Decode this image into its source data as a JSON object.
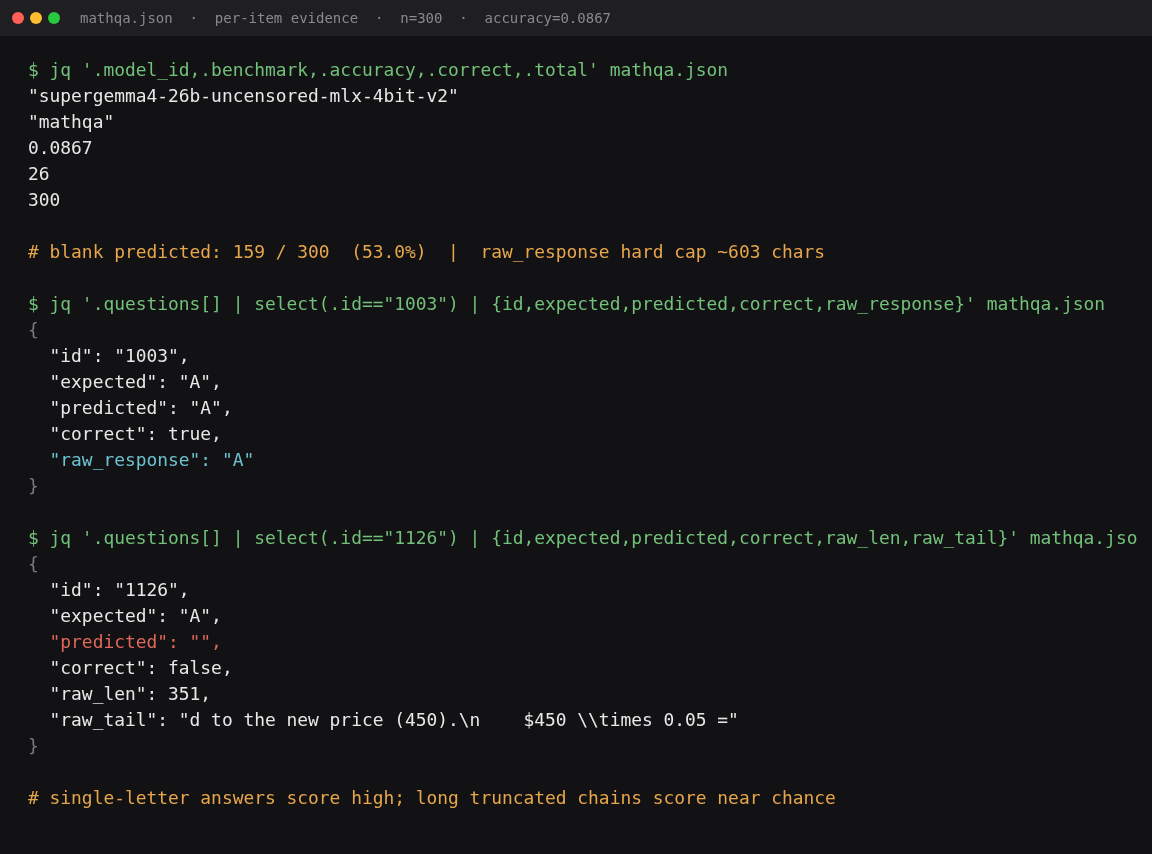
{
  "window": {
    "title": "mathqa.json  ·  per-item evidence  ·  n=300  ·  accuracy=0.0867"
  },
  "terminal": {
    "lines": [
      {
        "kind": "command",
        "text": "$ jq '.model_id,.benchmark,.accuracy,.correct,.total' mathqa.json"
      },
      {
        "kind": "output",
        "text": "\"supergemma4-26b-uncensored-mlx-4bit-v2\""
      },
      {
        "kind": "output",
        "text": "\"mathqa\""
      },
      {
        "kind": "output",
        "text": "0.0867"
      },
      {
        "kind": "output",
        "text": "26"
      },
      {
        "kind": "output",
        "text": "300"
      },
      {
        "kind": "blank"
      },
      {
        "kind": "comment",
        "text": "# blank predicted: 159 / 300  (53.0%)  |  raw_response hard cap ~603 chars"
      },
      {
        "kind": "blank"
      },
      {
        "kind": "command",
        "text": "$ jq '.questions[] | select(.id==\"1003\") | {id,expected,predicted,correct,raw_response}' mathqa.json"
      },
      {
        "kind": "brace",
        "text": "{"
      },
      {
        "kind": "output",
        "text": "  \"id\": \"1003\","
      },
      {
        "kind": "output",
        "text": "  \"expected\": \"A\","
      },
      {
        "kind": "output",
        "text": "  \"predicted\": \"A\","
      },
      {
        "kind": "output",
        "text": "  \"correct\": true,"
      },
      {
        "kind": "highlight",
        "text": "  \"raw_response\": \"A\""
      },
      {
        "kind": "brace",
        "text": "}"
      },
      {
        "kind": "blank"
      },
      {
        "kind": "command",
        "text": "$ jq '.questions[] | select(.id==\"1126\") | {id,expected,predicted,correct,raw_len,raw_tail}' mathqa.jso"
      },
      {
        "kind": "brace",
        "text": "{"
      },
      {
        "kind": "output",
        "text": "  \"id\": \"1126\","
      },
      {
        "kind": "output",
        "text": "  \"expected\": \"A\","
      },
      {
        "kind": "error",
        "text": "  \"predicted\": \"\","
      },
      {
        "kind": "output",
        "text": "  \"correct\": false,"
      },
      {
        "kind": "output",
        "text": "  \"raw_len\": 351,"
      },
      {
        "kind": "output",
        "text": "  \"raw_tail\": \"d to the new price (450).\\n    $450 \\\\times 0.05 =\""
      },
      {
        "kind": "brace",
        "text": "}"
      },
      {
        "kind": "blank"
      },
      {
        "kind": "comment",
        "text": "# single-letter answers score high; long truncated chains score near chance"
      }
    ]
  }
}
